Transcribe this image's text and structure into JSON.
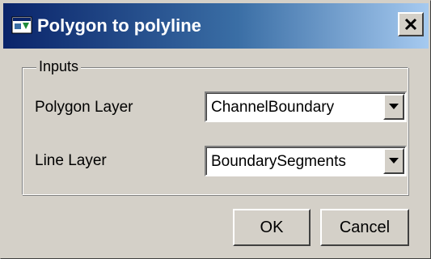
{
  "window": {
    "title": "Polygon to polyline",
    "title_icon": "app-window-icon",
    "close_icon": "close-icon"
  },
  "inputs_group": {
    "legend": "Inputs",
    "polygon_layer": {
      "label": "Polygon Layer",
      "selected": "ChannelBoundary",
      "icon": "chevron-down-icon"
    },
    "line_layer": {
      "label": "Line Layer",
      "selected": "BoundarySegments",
      "icon": "chevron-down-icon"
    }
  },
  "buttons": {
    "ok_label": "OK",
    "cancel_label": "Cancel"
  },
  "colors": {
    "title_gradient_start": "#0a246a",
    "title_gradient_end": "#a6caf0",
    "face": "#d4d0c8"
  }
}
